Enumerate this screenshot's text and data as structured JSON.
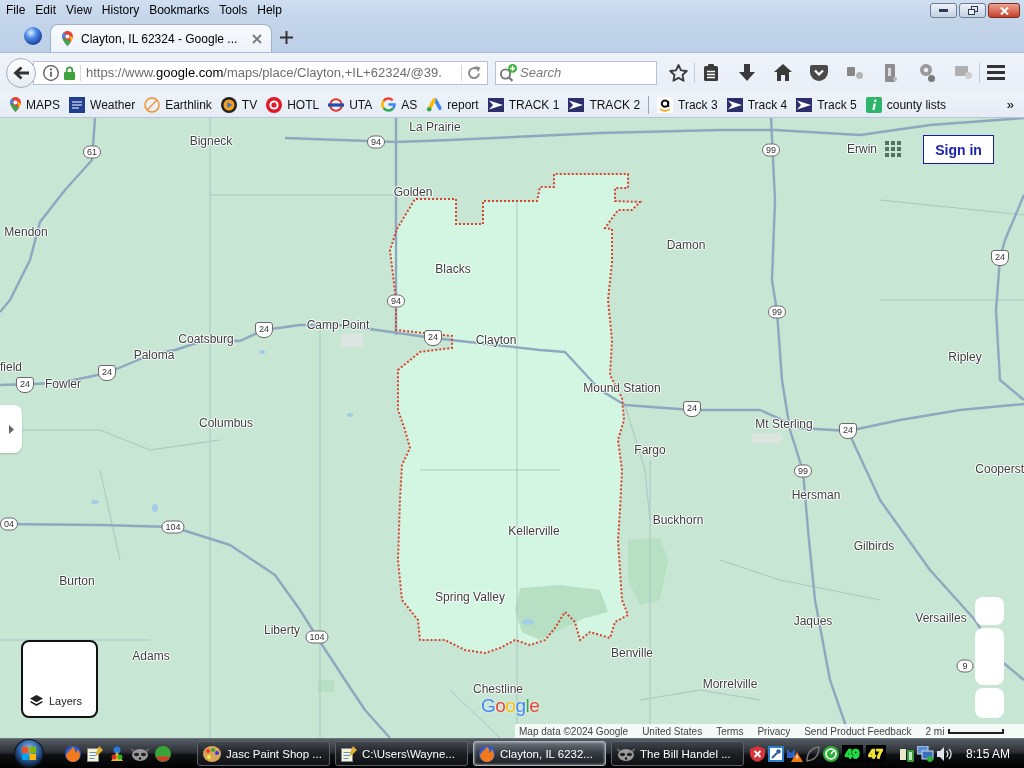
{
  "window": {
    "menu": [
      "File",
      "Edit",
      "View",
      "History",
      "Bookmarks",
      "Tools",
      "Help"
    ]
  },
  "tabs": [
    {
      "label": "Clayton, IL 62324 - Google ...",
      "selected": true
    }
  ],
  "address_bar": {
    "url": "https://www.**google.com**/maps/place/Clayton,+IL+62324/@39."
  },
  "search": {
    "placeholder": "Search"
  },
  "bookmarks": [
    {
      "kind": "maps-pin",
      "label": "MAPS"
    },
    {
      "kind": "weather",
      "label": "Weather"
    },
    {
      "kind": "ring",
      "label": "Earthlink"
    },
    {
      "kind": "tv",
      "label": "TV"
    },
    {
      "kind": "target",
      "label": "HOTL"
    },
    {
      "kind": "roundel",
      "label": "UTA"
    },
    {
      "kind": "g-logo",
      "label": "AS"
    },
    {
      "kind": "ads",
      "label": "report"
    },
    {
      "kind": "mail",
      "label": "TRACK 1"
    },
    {
      "kind": "mail",
      "label": "TRACK 2"
    },
    {
      "kind": "separator"
    },
    {
      "kind": "amazon",
      "label": "Track 3"
    },
    {
      "kind": "mail",
      "label": "Track 4"
    },
    {
      "kind": "mail",
      "label": "Track 5"
    },
    {
      "kind": "info",
      "label": "county lists"
    }
  ],
  "bookmarks_overflow": "»",
  "map": {
    "places": [
      "La Prairie",
      "Bigneck",
      "Erwin",
      "Golden",
      "Mendon",
      "Damon",
      "Blacks",
      "Camp Point",
      "Coatsburg",
      "Clayton",
      "Paloma",
      "Ripley",
      "field",
      "Fowler",
      "Mound Station",
      "Columbus",
      "Mt Sterling",
      "Fargo",
      "Cooperst",
      "Hersman",
      "Buckhorn",
      "Kellerville",
      "Gilbirds",
      "Burton",
      "Spring Valley",
      "Versailles",
      "Jaques",
      "Liberty",
      "Benville",
      "Adams",
      "Morrelville",
      "Chestline"
    ],
    "route_shields": [
      {
        "number": "94",
        "kind": "state"
      },
      {
        "number": "99",
        "kind": "state"
      },
      {
        "number": "61",
        "kind": "state"
      },
      {
        "number": "24",
        "kind": "us"
      },
      {
        "number": "94",
        "kind": "state"
      },
      {
        "number": "99",
        "kind": "state"
      },
      {
        "number": "24",
        "kind": "us"
      },
      {
        "number": "24",
        "kind": "us"
      },
      {
        "number": "24",
        "kind": "us"
      },
      {
        "number": "24",
        "kind": "us"
      },
      {
        "number": "24",
        "kind": "us"
      },
      {
        "number": "24",
        "kind": "us"
      },
      {
        "number": "99",
        "kind": "state"
      },
      {
        "number": "04",
        "kind": "state"
      },
      {
        "number": "104",
        "kind": "state"
      },
      {
        "number": "104",
        "kind": "state"
      },
      {
        "number": "9",
        "kind": "state"
      }
    ],
    "sign_in": "Sign in",
    "layers": "Layers",
    "logo": "Google",
    "footer": [
      "Map data ©2024 Google",
      "United States",
      "Terms",
      "Privacy",
      "Send Product Feedback"
    ],
    "scale": "2 mi"
  },
  "taskbar": {
    "tasks": [
      {
        "kind": "paint",
        "label": "Jasc Paint Shop ...",
        "selected": false
      },
      {
        "kind": "notepad",
        "label": "C:\\Users\\Wayne...",
        "selected": false
      },
      {
        "kind": "firefox",
        "label": "Clayton, IL 6232...",
        "selected": true
      },
      {
        "kind": "raccoon",
        "label": "The Bill Handel ...",
        "selected": false
      }
    ],
    "tray_counters": [
      {
        "value": "49",
        "color": "#22dd44"
      },
      {
        "value": "47",
        "color": "#f0e030"
      }
    ],
    "clock": "8:15 AM"
  }
}
